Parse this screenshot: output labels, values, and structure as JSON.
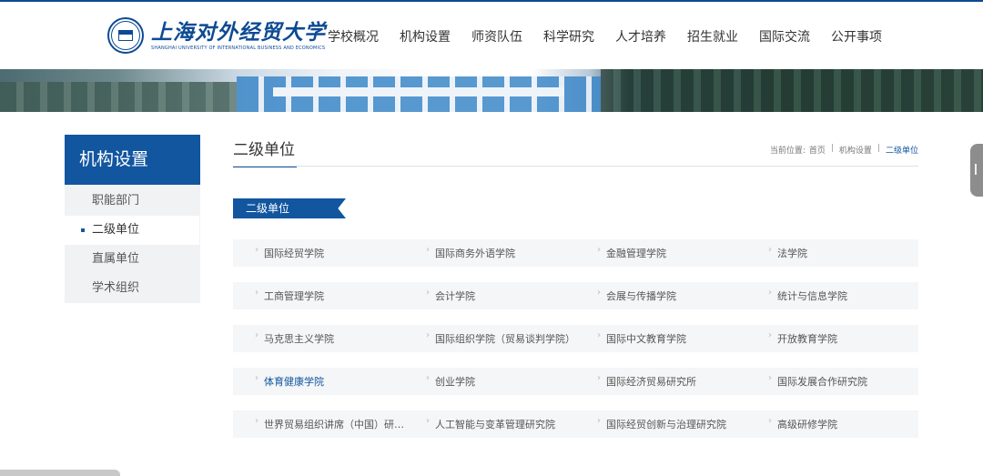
{
  "header": {
    "logo_cn": "上海对外经贸大学",
    "logo_en": "SHANGHAI UNIVERSITY OF INTERNATIONAL BUSINESS AND ECONOMICS",
    "nav": [
      "学校概况",
      "机构设置",
      "师资队伍",
      "科学研究",
      "人才培养",
      "招生就业",
      "国际交流",
      "公开事项"
    ]
  },
  "sidebar": {
    "title": "机构设置",
    "items": [
      {
        "label": "职能部门"
      },
      {
        "label": "二级单位"
      },
      {
        "label": "直属单位"
      },
      {
        "label": "学术组织"
      }
    ],
    "active_index": 1
  },
  "main": {
    "title": "二级单位",
    "breadcrumb": {
      "prefix": "当前位置:",
      "items": [
        "首页",
        "机构设置",
        "二级单位"
      ]
    },
    "section_label": "二级单位",
    "rows": [
      [
        "国际经贸学院",
        "国际商务外语学院",
        "金融管理学院",
        "法学院"
      ],
      [
        "工商管理学院",
        "会计学院",
        "会展与传播学院",
        "统计与信息学院"
      ],
      [
        "马克思主义学院",
        "国际组织学院（贸易谈判学院）",
        "国际中文教育学院",
        "开放教育学院"
      ],
      [
        "体育健康学院",
        "创业学院",
        "国际经济贸易研究所",
        "国际发展合作研究院"
      ],
      [
        "世界贸易组织讲席（中国）研究院",
        "人工智能与变革管理研究院",
        "国际经贸创新与治理研究院",
        "高级研修学院"
      ]
    ]
  },
  "colors": {
    "brand": "#1256a0",
    "highlight_text": "#1256a0",
    "row_bg": "#f5f6f7"
  }
}
